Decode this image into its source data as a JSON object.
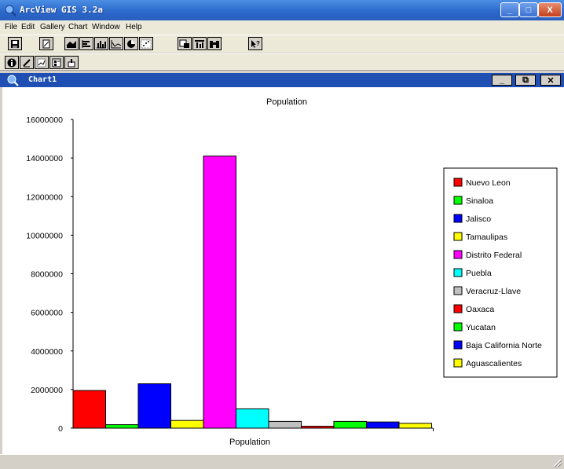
{
  "app": {
    "title": "ArcView GIS 3.2a"
  },
  "menu": {
    "items": [
      "File",
      "Edit",
      "Gallery",
      "Chart",
      "Window",
      "Help"
    ]
  },
  "window_controls": {
    "min": "_",
    "max": "□",
    "close": "X"
  },
  "chart_window": {
    "title": "Chart1",
    "controls": {
      "min": "_",
      "restore": "⧉",
      "close": "✕"
    }
  },
  "toolbar1": {
    "icons": [
      "save-icon",
      "properties-icon",
      "area-chart-icon",
      "bar-h-icon",
      "column-chart-icon",
      "line-chart-icon",
      "pie-chart-icon",
      "scatter-icon",
      "chart-element-icon",
      "chart-series-icon",
      "find-icon",
      "help-pointer-icon"
    ]
  },
  "toolbar2": {
    "icons": [
      "info-icon",
      "erase-icon",
      "title-icon",
      "legend-icon",
      "pointer-icon"
    ]
  },
  "colors": {
    "titlebar": "#2a67c9",
    "chart_title_bar": "#1f4fb2"
  },
  "chart_data": {
    "type": "bar",
    "title": "Population",
    "xlabel": "Population",
    "ylabel": "",
    "ylim": [
      0,
      16000000
    ],
    "yticks": [
      "0",
      "2000000",
      "4000000",
      "6000000",
      "8000000",
      "10000000",
      "12000000",
      "14000000",
      "16000000"
    ],
    "legend_position": "right",
    "series": [
      {
        "name": "Nuevo Leon",
        "value": 1950000,
        "color": "#ff0000"
      },
      {
        "name": "Sinaloa",
        "value": 180000,
        "color": "#00ff00"
      },
      {
        "name": "Jalisco",
        "value": 2300000,
        "color": "#0000ff"
      },
      {
        "name": "Tamaulipas",
        "value": 400000,
        "color": "#ffff00"
      },
      {
        "name": "Distrito Federal",
        "value": 14100000,
        "color": "#ff00ff"
      },
      {
        "name": "Puebla",
        "value": 1000000,
        "color": "#00ffff"
      },
      {
        "name": "Veracruz-Llave",
        "value": 350000,
        "color": "#c0c0c0"
      },
      {
        "name": "Oaxaca",
        "value": 100000,
        "color": "#ff0000"
      },
      {
        "name": "Yucatan",
        "value": 350000,
        "color": "#00ff00"
      },
      {
        "name": "Baja California Norte",
        "value": 320000,
        "color": "#0000ff"
      },
      {
        "name": "Aguascalientes",
        "value": 250000,
        "color": "#ffff00"
      }
    ]
  }
}
